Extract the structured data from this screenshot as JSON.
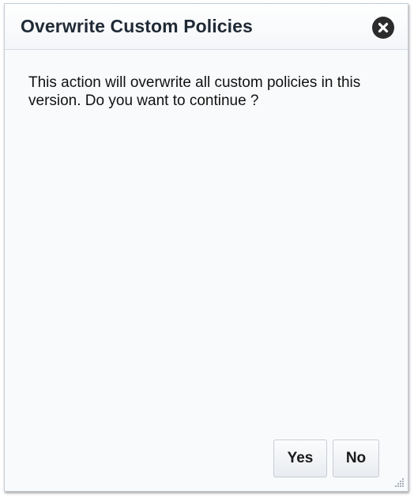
{
  "dialog": {
    "title": "Overwrite Custom Policies",
    "close_icon": "close-circle-icon",
    "message": "This action will overwrite all custom policies in this version. Do you want to continue ?",
    "buttons": {
      "yes_label": "Yes",
      "no_label": "No"
    },
    "resize_icon": "resize-grip-icon"
  },
  "colors": {
    "title_text": "#1f2a35",
    "dialog_background": "#f9fafc",
    "close_button": "#2b2b2b",
    "border": "#c5ccd6"
  }
}
